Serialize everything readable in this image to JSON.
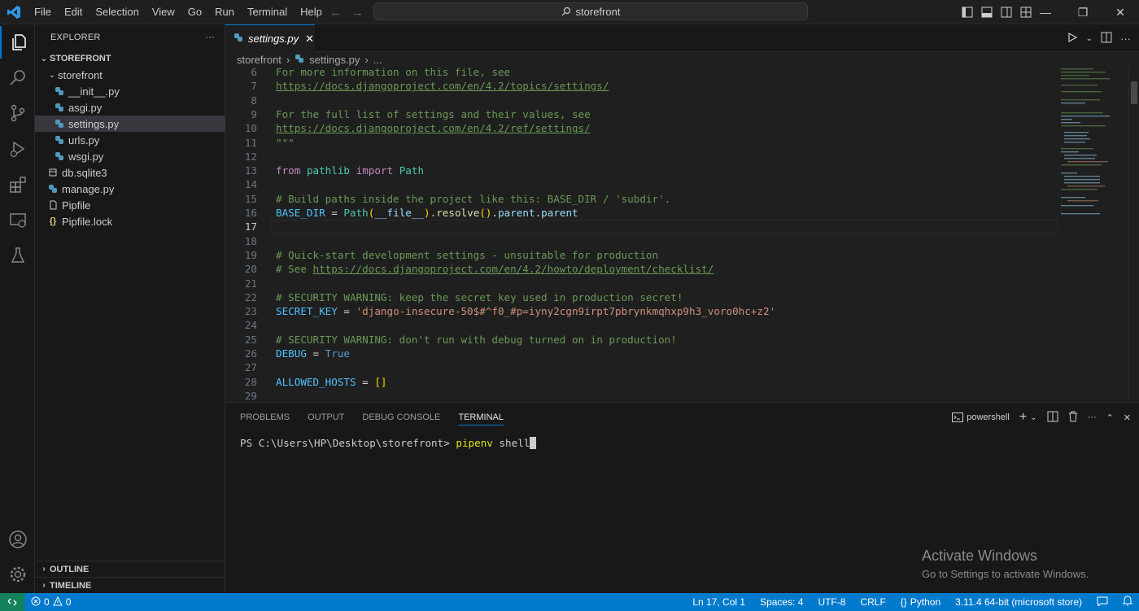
{
  "titlebar": {
    "menu": [
      "File",
      "Edit",
      "Selection",
      "View",
      "Go",
      "Run",
      "Terminal",
      "Help"
    ],
    "search_text": "storefront"
  },
  "sidebar": {
    "title": "EXPLORER",
    "root": "STOREFRONT",
    "folder": "storefront",
    "files": [
      "__init__.py",
      "asgi.py",
      "settings.py",
      "urls.py",
      "wsgi.py"
    ],
    "root_files": [
      "db.sqlite3",
      "manage.py",
      "Pipfile",
      "Pipfile.lock"
    ],
    "outline": "OUTLINE",
    "timeline": "TIMELINE"
  },
  "editor": {
    "tab_label": "settings.py",
    "breadcrumb": {
      "folder": "storefront",
      "file": "settings.py",
      "more": "..."
    },
    "current_line": 17,
    "lines": [
      {
        "n": "6",
        "tokens": [
          [
            "c-com",
            "For more information on this file, see"
          ]
        ]
      },
      {
        "n": "7",
        "tokens": [
          [
            "c-link",
            "https://docs.djangoproject.com/en/4.2/topics/settings/"
          ]
        ]
      },
      {
        "n": "8",
        "tokens": []
      },
      {
        "n": "9",
        "tokens": [
          [
            "c-com",
            "For the full list of settings and their values, see"
          ]
        ]
      },
      {
        "n": "10",
        "tokens": [
          [
            "c-link",
            "https://docs.djangoproject.com/en/4.2/ref/settings/"
          ]
        ]
      },
      {
        "n": "11",
        "tokens": [
          [
            "c-com",
            "\"\"\""
          ]
        ]
      },
      {
        "n": "12",
        "tokens": []
      },
      {
        "n": "13",
        "tokens": [
          [
            "c-kw",
            "from"
          ],
          [
            "c-plain",
            " "
          ],
          [
            "c-cls",
            "pathlib"
          ],
          [
            "c-plain",
            " "
          ],
          [
            "c-kw",
            "import"
          ],
          [
            "c-plain",
            " "
          ],
          [
            "c-cls",
            "Path"
          ]
        ]
      },
      {
        "n": "14",
        "tokens": []
      },
      {
        "n": "15",
        "tokens": [
          [
            "c-com",
            "# Build paths inside the project like this: BASE_DIR / 'subdir'."
          ]
        ]
      },
      {
        "n": "16",
        "tokens": [
          [
            "c-var",
            "BASE_DIR"
          ],
          [
            "c-plain",
            " = "
          ],
          [
            "c-cls",
            "Path"
          ],
          [
            "c-par",
            "("
          ],
          [
            "c-attr",
            "__file__"
          ],
          [
            "c-par",
            ")"
          ],
          [
            "c-plain",
            "."
          ],
          [
            "c-fn",
            "resolve"
          ],
          [
            "c-par",
            "()"
          ],
          [
            "c-plain",
            "."
          ],
          [
            "c-attr",
            "parent"
          ],
          [
            "c-plain",
            "."
          ],
          [
            "c-attr",
            "parent"
          ]
        ]
      },
      {
        "n": "17",
        "tokens": []
      },
      {
        "n": "18",
        "tokens": []
      },
      {
        "n": "19",
        "tokens": [
          [
            "c-com",
            "# Quick-start development settings - unsuitable for production"
          ]
        ]
      },
      {
        "n": "20",
        "tokens": [
          [
            "c-com",
            "# See "
          ],
          [
            "c-link",
            "https://docs.djangoproject.com/en/4.2/howto/deployment/checklist/"
          ]
        ]
      },
      {
        "n": "21",
        "tokens": []
      },
      {
        "n": "22",
        "tokens": [
          [
            "c-com",
            "# SECURITY WARNING: keep the secret key used in production secret!"
          ]
        ]
      },
      {
        "n": "23",
        "tokens": [
          [
            "c-var",
            "SECRET_KEY"
          ],
          [
            "c-plain",
            " = "
          ],
          [
            "c-str",
            "'django-insecure-50$#^f0_#p=iyny2cgn9irpt7pbrynkmqhxp9h3_voro0hc+z2'"
          ]
        ]
      },
      {
        "n": "24",
        "tokens": []
      },
      {
        "n": "25",
        "tokens": [
          [
            "c-com",
            "# SECURITY WARNING: don't run with debug turned on in production!"
          ]
        ]
      },
      {
        "n": "26",
        "tokens": [
          [
            "c-var",
            "DEBUG"
          ],
          [
            "c-plain",
            " = "
          ],
          [
            "c-const",
            "True"
          ]
        ]
      },
      {
        "n": "27",
        "tokens": []
      },
      {
        "n": "28",
        "tokens": [
          [
            "c-var",
            "ALLOWED_HOSTS"
          ],
          [
            "c-plain",
            " = "
          ],
          [
            "c-par",
            "[]"
          ]
        ]
      },
      {
        "n": "29",
        "tokens": []
      }
    ]
  },
  "panel": {
    "tabs": [
      "PROBLEMS",
      "OUTPUT",
      "DEBUG CONSOLE",
      "TERMINAL"
    ],
    "active_tab": "TERMINAL",
    "shell_name": "powershell",
    "prompt": "PS C:\\Users\\HP\\Desktop\\storefront> ",
    "command": "pipenv",
    "args": " shell"
  },
  "watermark": {
    "line1": "Activate Windows",
    "line2": "Go to Settings to activate Windows."
  },
  "statusbar": {
    "errors": "0",
    "warnings": "0",
    "position": "Ln 17, Col 1",
    "spaces": "Spaces: 4",
    "encoding": "UTF-8",
    "eol": "CRLF",
    "language": "Python",
    "interpreter": "3.11.4 64-bit (microsoft store)"
  },
  "colors": {
    "accent": "#007acc",
    "remote": "#16825d",
    "python_icon": "#519aba"
  }
}
